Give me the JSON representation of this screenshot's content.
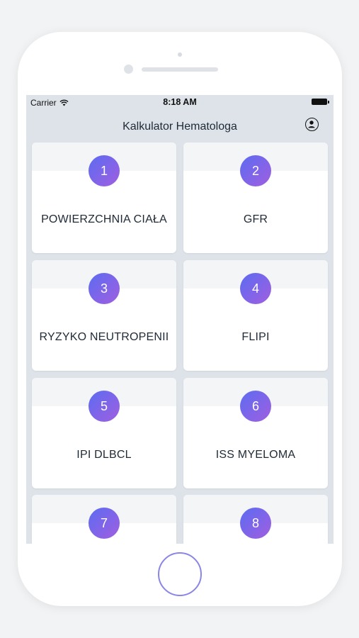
{
  "status_bar": {
    "carrier": "Carrier",
    "time": "8:18 AM"
  },
  "nav": {
    "title": "Kalkulator Hematologa",
    "profile_icon": "person-circle-icon"
  },
  "cards": [
    {
      "number": "1",
      "title": "POWIERZCHNIA CIAŁA"
    },
    {
      "number": "2",
      "title": "GFR"
    },
    {
      "number": "3",
      "title": "RYZYKO NEUTROPENII"
    },
    {
      "number": "4",
      "title": "FLIPI"
    },
    {
      "number": "5",
      "title": "IPI DLBCL"
    },
    {
      "number": "6",
      "title": "ISS MYELOMA"
    },
    {
      "number": "7",
      "title": ""
    },
    {
      "number": "8",
      "title": ""
    }
  ],
  "colors": {
    "accent_start": "#5b6cf2",
    "accent_end": "#a15ee0",
    "screen_bg": "#dde3e9"
  }
}
